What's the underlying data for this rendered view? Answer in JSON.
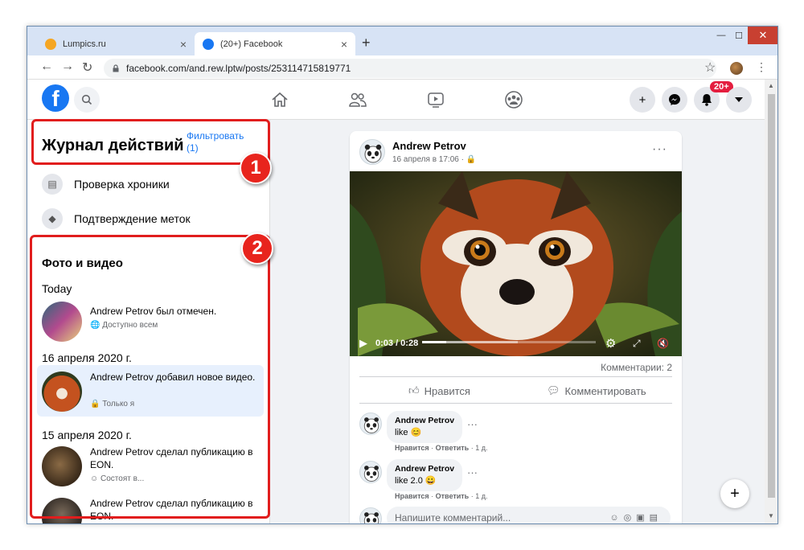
{
  "browser": {
    "tabs": [
      {
        "label": "Lumpics.ru",
        "close": "×"
      },
      {
        "label": "(20+) Facebook",
        "close": "×"
      }
    ],
    "new_tab": "+",
    "window_controls": {
      "minimize": "—",
      "maximize": "☐",
      "close": "✕"
    },
    "url": "facebook.com/and.rew.lptw/posts/253114715819771",
    "nav": {
      "back": "←",
      "forward": "→",
      "reload": "↻",
      "star": "☆",
      "menu": "⋮"
    }
  },
  "header": {
    "logo": "f",
    "search_icon": "search-icon",
    "nav_icons": [
      "home-icon",
      "friends-icon",
      "watch-icon",
      "groups-icon"
    ],
    "right_buttons": [
      "+",
      "messenger-icon",
      "bell-icon",
      "caret-icon"
    ],
    "notifications_badge": "20+"
  },
  "sidebar": {
    "title": "Журнал действий",
    "filter_label": "Фильтровать",
    "filter_count": "(1)",
    "menu": [
      {
        "label": "Проверка хроники",
        "icon": "timeline-icon"
      },
      {
        "label": "Подтверждение меток",
        "icon": "tag-icon"
      }
    ],
    "section_title": "Фото и видео",
    "groups": [
      {
        "day": "Today",
        "items": [
          {
            "text": "Andrew Petrov был отмечен.",
            "meta": "Доступно всем",
            "meta_icon": "globe-icon"
          }
        ]
      },
      {
        "day": "16 апреля 2020 г.",
        "items": [
          {
            "text": "Andrew Petrov добавил новое видео.",
            "meta": "Только я",
            "meta_icon": "lock-icon"
          }
        ]
      },
      {
        "day": "15 апреля 2020 г.",
        "items": [
          {
            "text": "Andrew Petrov сделал публикацию в EON.",
            "meta": "Состоят в...",
            "meta_icon": "group-icon"
          },
          {
            "text": "Andrew Petrov сделал публикацию в EON.",
            "meta": "",
            "meta_icon": ""
          }
        ]
      }
    ]
  },
  "annotations": {
    "badge1": "1",
    "badge2": "2"
  },
  "post": {
    "author": "Andrew Petrov",
    "date": "16 апреля в 17:06 · 🔒",
    "more": "···",
    "video": {
      "time": "0:03 / 0:28",
      "progress": 0.14,
      "buffered": 0.55
    },
    "comments_count": "Комментарии: 2",
    "like_label": "Нравится",
    "comment_label": "Комментировать",
    "comments": [
      {
        "author": "Andrew Petrov",
        "text": "like 😊",
        "like": "Нравится",
        "reply": "Ответить",
        "time": "1 д."
      },
      {
        "author": "Andrew Petrov",
        "text": "like 2.0 😀",
        "like": "Нравится",
        "reply": "Ответить",
        "time": "1 д."
      }
    ],
    "input_placeholder": "Напишите комментарий..."
  },
  "fab": "+"
}
